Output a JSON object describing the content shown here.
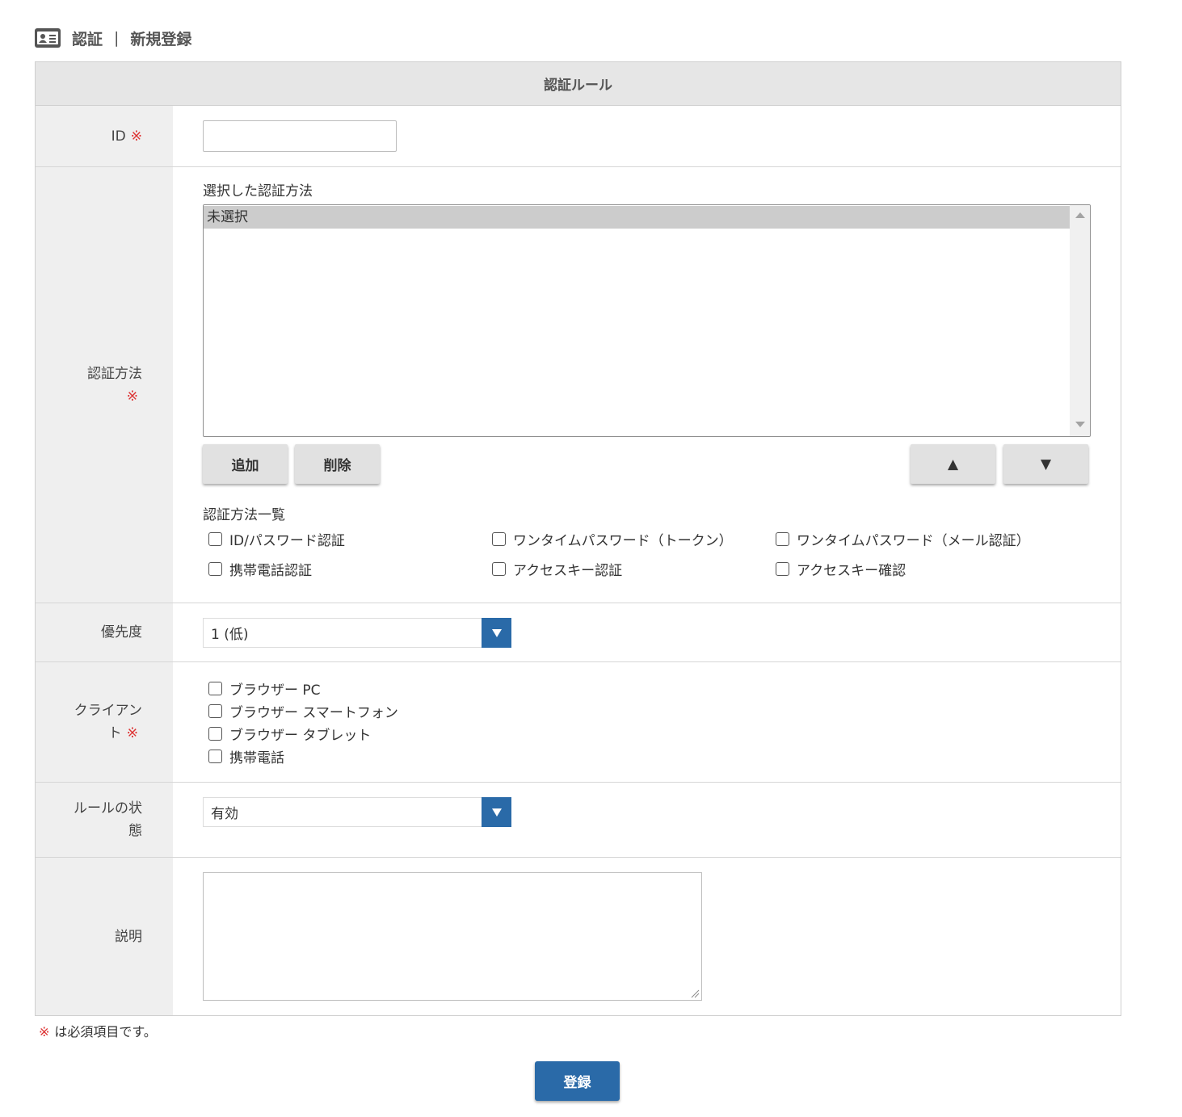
{
  "header": {
    "icon": "id-card-icon",
    "section": "認証",
    "separator": "|",
    "page": "新規登録"
  },
  "table": {
    "title": "認証ルール",
    "required_mark": "※",
    "rows": {
      "id": {
        "label": "ID",
        "value": ""
      },
      "auth_method": {
        "label": "認証方法",
        "selected_label": "選択した認証方法",
        "selected_items": [
          "未選択"
        ],
        "add_button": "追加",
        "delete_button": "削除",
        "move_up_button": "▲",
        "move_down_button": "▼",
        "list_label": "認証方法一覧",
        "options": [
          "ID/パスワード認証",
          "ワンタイムパスワード（トークン）",
          "ワンタイムパスワード（メール認証）",
          "携帯電話認証",
          "アクセスキー認証",
          "アクセスキー確認"
        ]
      },
      "priority": {
        "label": "優先度",
        "selected": "1 (低)"
      },
      "client": {
        "label_line1": "クライアン",
        "label_line2": "ト",
        "options": [
          "ブラウザー PC",
          "ブラウザー スマートフォン",
          "ブラウザー タブレット",
          "携帯電話"
        ]
      },
      "rule_status": {
        "label_line1": "ルールの状",
        "label_line2": "態",
        "selected": "有効"
      },
      "description": {
        "label": "説明",
        "value": ""
      }
    }
  },
  "footer": {
    "required_note": "は必須項目です。",
    "submit_button": "登録"
  },
  "colors": {
    "accent": "#2a6aa8",
    "required": "#dd3333",
    "label_bg": "#efefef",
    "header_bg": "#e6e6e6"
  }
}
